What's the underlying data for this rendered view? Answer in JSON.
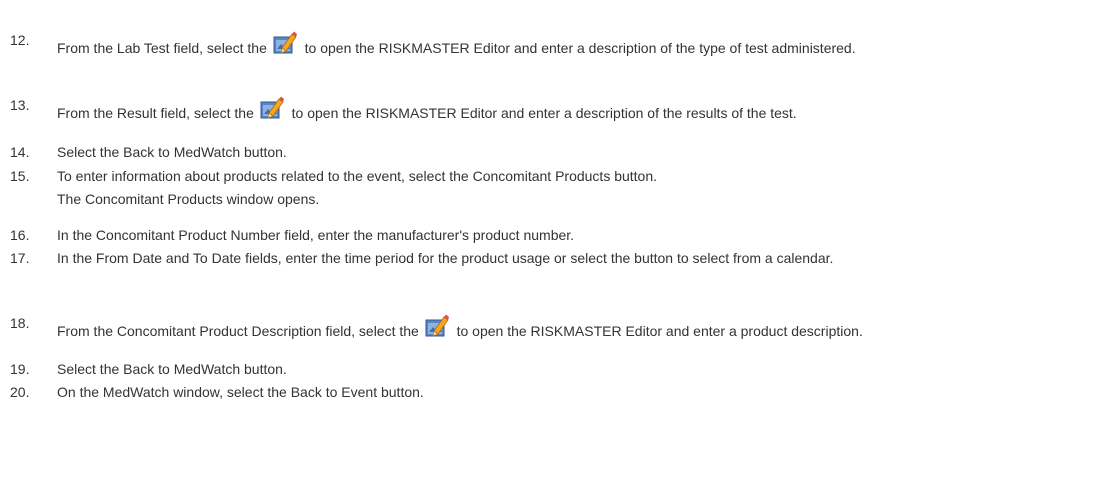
{
  "steps": [
    {
      "number": "12.",
      "before": "From the Lab Test field, select the",
      "after": " to open the RISKMASTER Editor and enter a description of the type of test administered."
    },
    {
      "number": "13.",
      "before": "From the Result field, select the",
      "after": " to open the RISKMASTER Editor and enter a description of the results of the test."
    },
    {
      "number": "14.",
      "text": "Select the Back to MedWatch button."
    },
    {
      "number": "15.",
      "text": "To enter information about products related to the event, select the Concomitant Products button.",
      "result": "The Concomitant Products window opens."
    },
    {
      "number": "16.",
      "text": "In the Concomitant Product Number field, enter the manufacturer's product number."
    },
    {
      "number": "17.",
      "text": "In the From Date and To Date fields, enter the time period for the product usage or select the button to select from a calendar."
    },
    {
      "number": "18.",
      "before": "From the Concomitant Product Description field, select the",
      "after": " to open the RISKMASTER Editor and enter a product description."
    },
    {
      "number": "19.",
      "text": "Select the Back to MedWatch button."
    },
    {
      "number": "20.",
      "text": "On the MedWatch window, select the Back to Event button."
    }
  ],
  "icons": {
    "editor": "riskmaster-editor-icon"
  }
}
